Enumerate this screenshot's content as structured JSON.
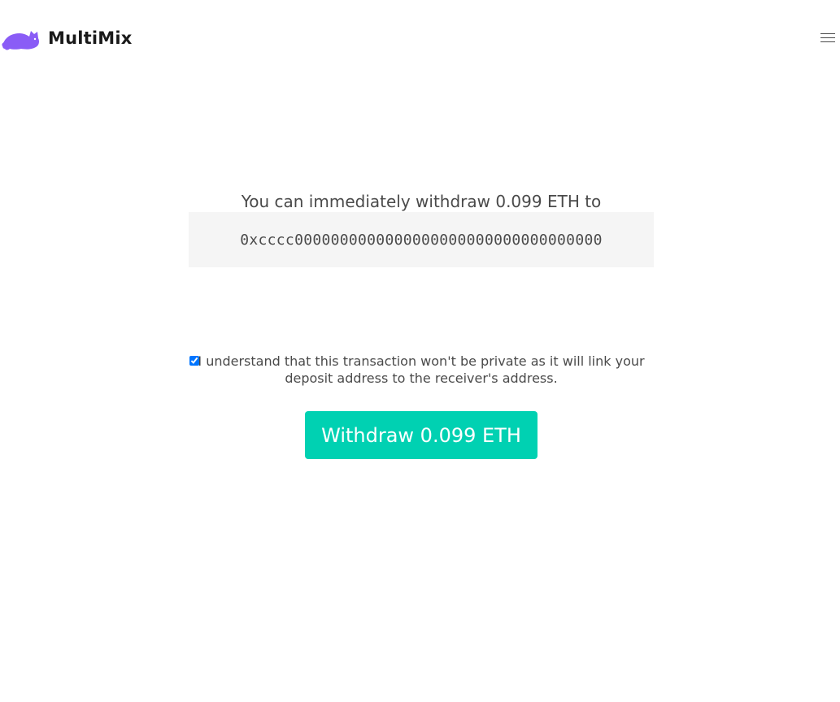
{
  "brand": {
    "name": "MultiMix",
    "logo_icon": "cat-icon",
    "logo_color": "#8a5cf6"
  },
  "nav": {
    "menu_icon": "hamburger-menu-icon"
  },
  "withdraw": {
    "intro": "You can immediately withdraw 0.099 ETH to",
    "address": "0xcccc0000000000000000000000000000000000",
    "consent_checked": true,
    "consent_text": "I understand that this transaction won't be private as it will link your deposit address to the receiver's address.",
    "button_label": "Withdraw 0.099 ETH"
  },
  "colors": {
    "primary": "#00d1b2",
    "text": "#4a4a4a",
    "address_bg": "#f5f5f5"
  }
}
